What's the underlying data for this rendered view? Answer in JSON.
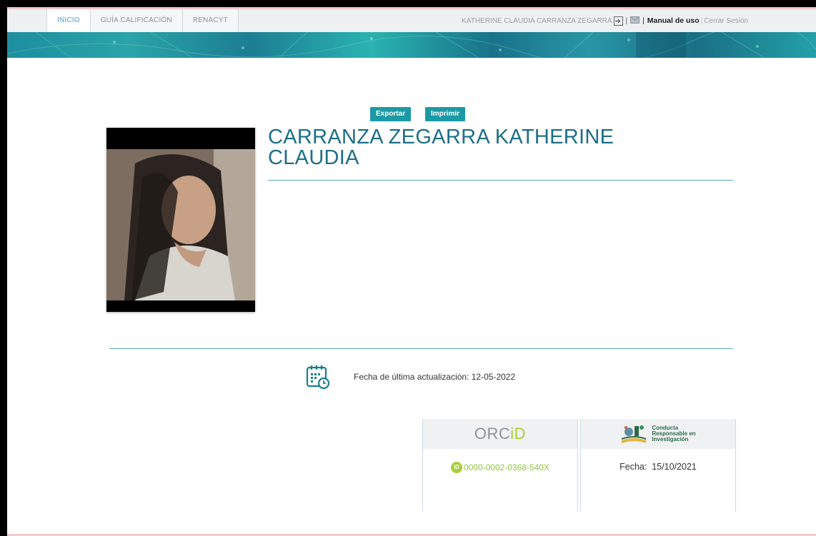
{
  "nav": {
    "tabs": [
      "INICIO",
      "GUÍA CALIFICACIÓN",
      "RENACYT"
    ],
    "user_name": "KATHERINE CLAUDIA CARRANZA ZEGARRA",
    "manual_label": "Manual de uso",
    "logout_label": "Cerrar Sesión"
  },
  "actions": {
    "export_label": "Exportar",
    "print_label": "Imprimir"
  },
  "profile": {
    "name_line1": "CARRANZA ZEGARRA KATHERINE",
    "name_line2": "CLAUDIA"
  },
  "update": {
    "text": "Fecha de última actualización: 12-05-2022"
  },
  "orcid": {
    "logo_main": "ORC",
    "logo_id": "iD",
    "badge": "iD",
    "number": "0000-0002-0368-540X"
  },
  "crl": {
    "line1": "Conducta",
    "line2": "Responsable en",
    "line3": "Investigación",
    "fecha_label": "Fecha:",
    "fecha_value": "15/10/2021"
  },
  "colors": {
    "accent": "#1b9aa5",
    "title": "#1d6e87",
    "orcid_green": "#a6ce39"
  }
}
